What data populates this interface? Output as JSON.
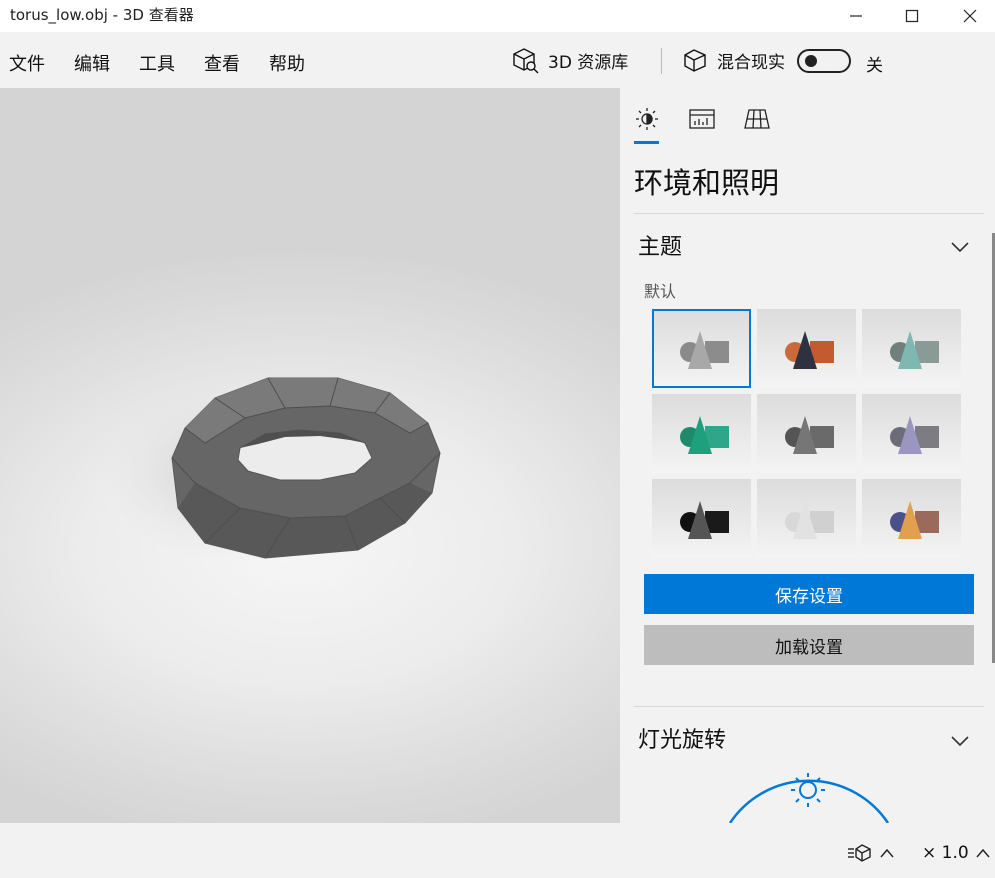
{
  "window": {
    "title": "torus_low.obj - 3D 查看器"
  },
  "menu": {
    "file": "文件",
    "edit": "编辑",
    "tools": "工具",
    "view": "查看",
    "help": "帮助"
  },
  "toolbar": {
    "library_label": "3D 资源库",
    "mixed_reality_label": "混合现实",
    "toggle_state": "关"
  },
  "panel": {
    "title": "环境和照明",
    "theme_section": "主题",
    "theme_default_label": "默认",
    "save_button": "保存设置",
    "load_button": "加载设置",
    "light_rotation_section": "灯光旋转"
  },
  "status": {
    "zoom": "× 1.0"
  },
  "colors": {
    "accent": "#0078d7",
    "model": "#6e6e6e",
    "secondary_button": "#bdbdbd"
  },
  "icons": [
    "sun-icon",
    "stats-icon",
    "grid-icon",
    "cube-library-icon",
    "mixed-reality-icon",
    "chevron-down-icon",
    "chevron-up-icon",
    "light-sun-icon"
  ]
}
